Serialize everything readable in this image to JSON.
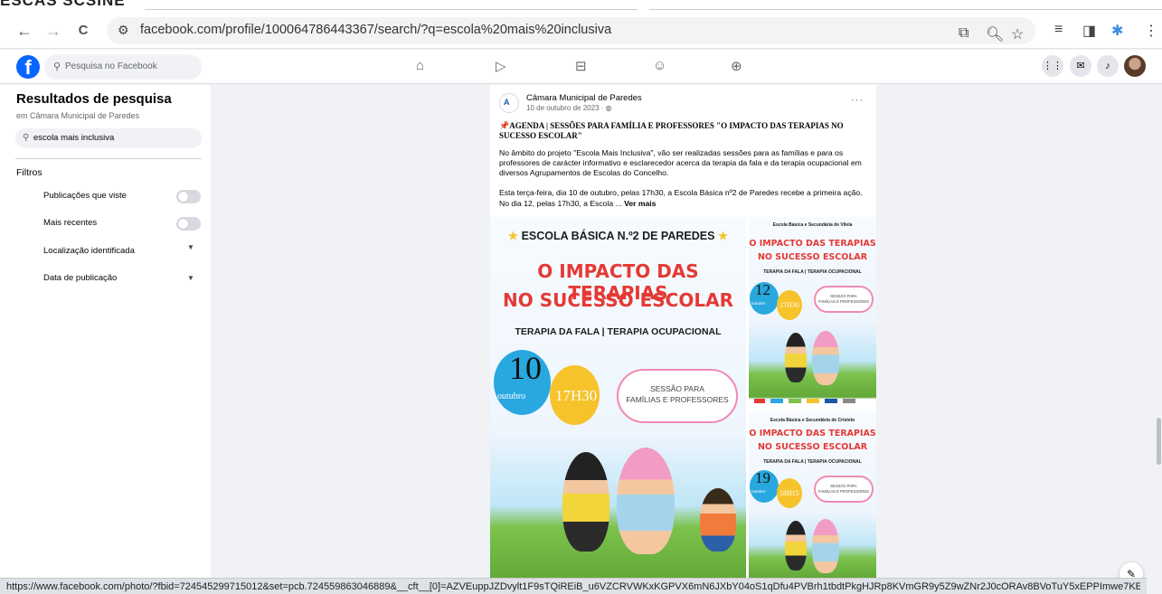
{
  "clip_text": "ESCAS SCSINE",
  "browser": {
    "back": "←",
    "forward": "→",
    "reload": "C",
    "site_info": "⚙",
    "url": "facebook.com/profile/100064786443367/search/?q=escola%20mais%20inclusiva"
  },
  "fb": {
    "logo": "f",
    "search_placeholder": "Pesquisa no Facebook",
    "nav_icons": [
      "home-icon",
      "video-icon",
      "marketplace-icon",
      "groups-icon",
      "gaming-icon"
    ]
  },
  "sidebar": {
    "title": "Resultados de pesquisa",
    "subtitle": "em Câmara Municipal de Paredes",
    "search_value": "escola mais inclusiva",
    "filters_label": "Filtros",
    "filters": [
      {
        "label": "Publicações que viste",
        "control": "toggle"
      },
      {
        "label": "Mais recentes",
        "control": "toggle"
      },
      {
        "label": "Localização identificada",
        "control": "dropdown"
      },
      {
        "label": "Data de publicação",
        "control": "dropdown"
      }
    ]
  },
  "post": {
    "page_name": "Câmara Municipal de Paredes",
    "date": "10 de outubro de 2023 · ",
    "more": "···",
    "headline": "📌AGENDA | SESSÕES PARA FAMÍLIA E PROFESSORES \"O IMPACTO DAS TERAPIAS NO SUCESSO ESCOLAR\"",
    "body": "No âmbito do projeto \"Escola Mais Inclusiva\", vão ser realizadas sessões para as famílias e para os professores de carácter informativo e esclarecedor acerca da terapia da fala e da terapia ocupacional em diversos Agrupamentos de Escolas do Concelho.",
    "body2": "Esta terça-feira, dia 10 de outubro, pelas 17h30, a Escola Básica nº2 de Paredes recebe a primeira ação. No dia 12, pelas 17h30, a Escola ... ",
    "see_more": "Ver mais",
    "images": {
      "main": {
        "school": "ESCOLA BÁSICA N.º2 DE PAREDES",
        "title1": "O IMPACTO DAS TERAPIAS",
        "title2": "NO SUCESSO ESCOLAR",
        "sub": "TERAPIA DA FALA | TERAPIA OCUPACIONAL",
        "day": "10",
        "month": "outubro",
        "time": "17H30",
        "cloud1": "SESSÃO PARA",
        "cloud2": "FAMÍLIAS E PROFESSORES"
      },
      "side1": {
        "school": "Escola Básica e Secundária de Vilela",
        "title1": "O IMPACTO DAS TERAPIAS",
        "title2": "NO SUCESSO ESCOLAR",
        "sub": "TERAPIA DA FALA | TERAPIA OCUPACIONAL",
        "day": "12",
        "month": "outubro",
        "time": "17H30",
        "cloud1": "SESSÃO PARA",
        "cloud2": "FAMÍLIAS E PROFESSORES"
      },
      "side2": {
        "school": "Escola Básica e Secundária de Cristelo",
        "title1": "O IMPACTO DAS TERAPIAS",
        "title2": "NO SUCESSO ESCOLAR",
        "sub": "TERAPIA DA FALA | TERAPIA OCUPACIONAL",
        "day": "19",
        "month": "outubro",
        "time": "18H15",
        "cloud1": "SESSÃO PARA",
        "cloud2": "FAMÍLIAS E PROFESSORES"
      }
    }
  },
  "status_url": "https://www.facebook.com/photo/?fbid=724545299715012&set=pcb.724559863046889&__cft__[0]=AZVEuppJZDvylt1F9sTQiREiB_u6VZCRVWKxKGPVX6mN6JXbY04oS1qDfu4PVBrh1tbdtPkgHJRp8KVmGR9y5Z9wZNr2J0cORAv8BVoTuY5xEPPImwe7KE...",
  "colors": {
    "fb_blue": "#0866ff",
    "title_red": "#e53935",
    "balloon_blue": "#29a8e0",
    "balloon_yellow": "#f6c32b"
  }
}
